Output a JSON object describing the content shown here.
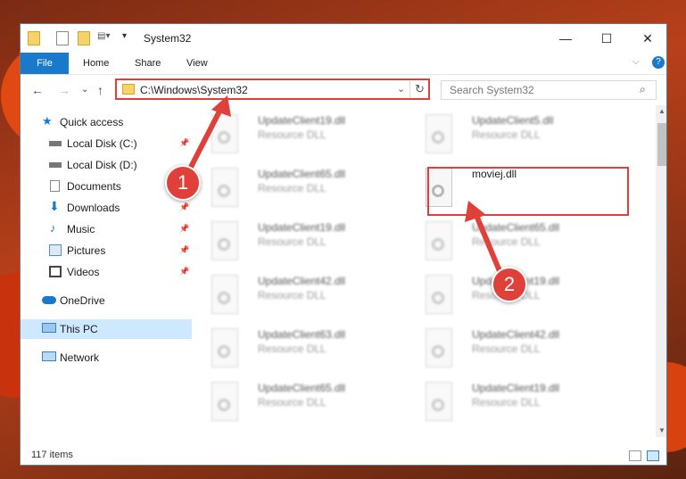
{
  "window": {
    "title": "System32"
  },
  "ribbon": {
    "tabs": [
      "File",
      "Home",
      "Share",
      "View"
    ]
  },
  "address": {
    "path": "C:\\Windows\\System32",
    "search_placeholder": "Search System32"
  },
  "nav": {
    "items": [
      {
        "label": "Quick access",
        "pinned": false
      },
      {
        "label": "Local Disk (C:)",
        "pinned": true
      },
      {
        "label": "Local Disk (D:)",
        "pinned": false
      },
      {
        "label": "Documents",
        "pinned": true
      },
      {
        "label": "Downloads",
        "pinned": true
      },
      {
        "label": "Music",
        "pinned": true
      },
      {
        "label": "Pictures",
        "pinned": true
      },
      {
        "label": "Videos",
        "pinned": true
      },
      {
        "label": "OneDrive",
        "pinned": false
      },
      {
        "label": "This PC",
        "pinned": false,
        "selected": true
      },
      {
        "label": "Network",
        "pinned": false
      }
    ]
  },
  "files": {
    "left": [
      {
        "name": "UpdateClient19.dll",
        "type": "Resource DLL"
      },
      {
        "name": "UpdateClient65.dll",
        "type": "Resource DLL"
      },
      {
        "name": "UpdateClient19.dll",
        "type": "Resource DLL"
      },
      {
        "name": "UpdateClient42.dll",
        "type": "Resource DLL"
      },
      {
        "name": "UpdateClient63.dll",
        "type": "Resource DLL"
      },
      {
        "name": "UpdateClient65.dll",
        "type": "Resource DLL"
      }
    ],
    "right": [
      {
        "name": "UpdateClient5.dll",
        "type": "Resource DLL"
      },
      {
        "name": "moviej.dll",
        "type": ""
      },
      {
        "name": "UpdateClient65.dll",
        "type": "Resource DLL"
      },
      {
        "name": "UpdateClient19.dll",
        "type": "Resource DLL"
      },
      {
        "name": "UpdateClient42.dll",
        "type": "Resource DLL"
      },
      {
        "name": "UpdateClient19.dll",
        "type": "Resource DLL"
      }
    ]
  },
  "status": {
    "count": "117 items"
  },
  "annotations": {
    "step1": "1",
    "step2": "2"
  },
  "colors": {
    "accent": "#1979ca",
    "highlight": "#e0403a",
    "selected": "#cde8ff"
  }
}
